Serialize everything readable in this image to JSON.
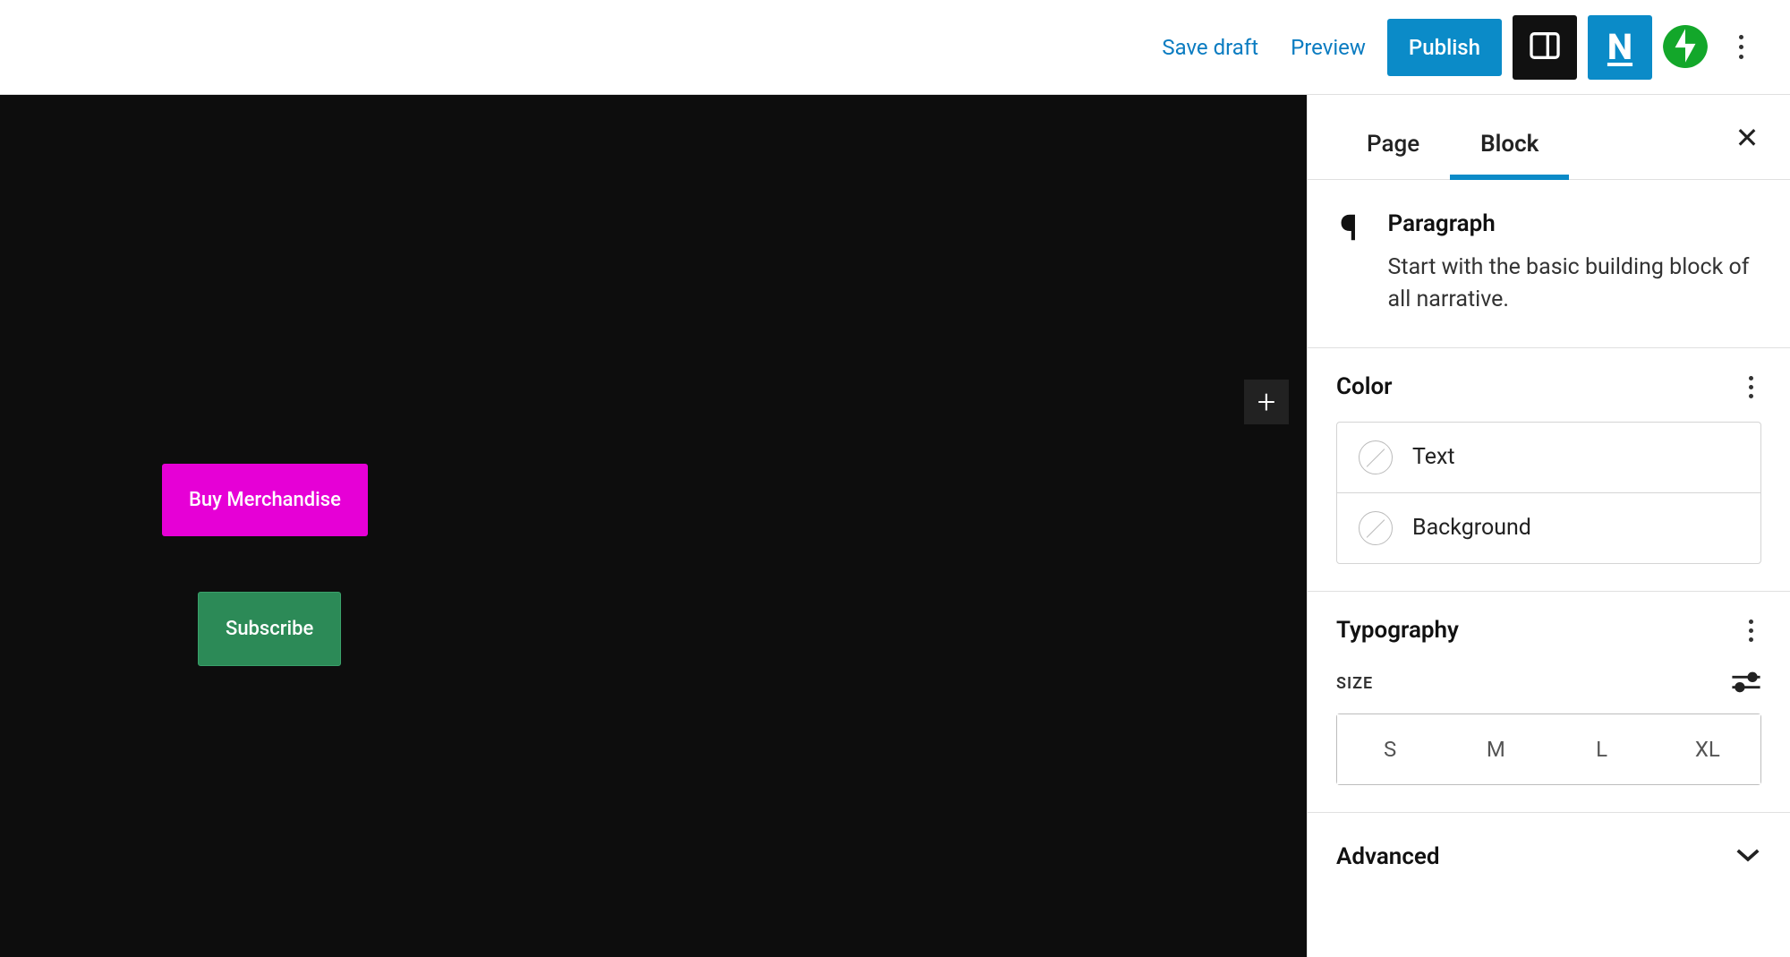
{
  "topbar": {
    "save_draft": "Save draft",
    "preview": "Preview",
    "publish": "Publish",
    "n_label": "N"
  },
  "canvas": {
    "buttons": {
      "buy": "Buy Merchandise",
      "subscribe": "Subscribe"
    }
  },
  "sidebar": {
    "tabs": {
      "page": "Page",
      "block": "Block"
    },
    "block": {
      "title": "Paragraph",
      "description": "Start with the basic building block of all narrative."
    },
    "sections": {
      "color": {
        "title": "Color",
        "items": {
          "text": "Text",
          "background": "Background"
        }
      },
      "typography": {
        "title": "Typography",
        "size_label": "SIZE",
        "sizes": [
          "S",
          "M",
          "L",
          "XL"
        ]
      },
      "advanced": {
        "title": "Advanced"
      }
    }
  }
}
